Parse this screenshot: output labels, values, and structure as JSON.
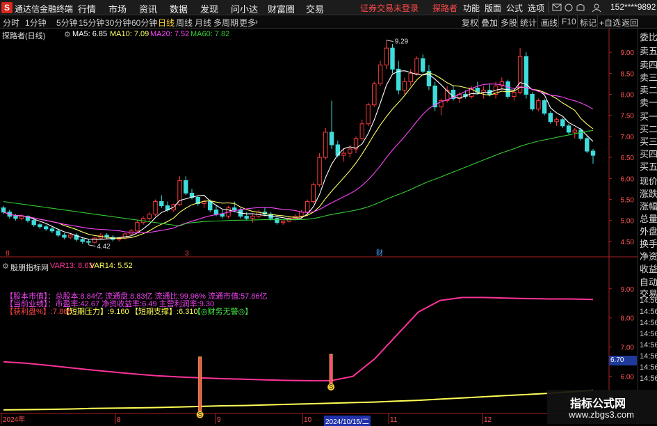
{
  "app": {
    "logo": "S",
    "title": "通达信金融终端",
    "menu": [
      "行情",
      "市场",
      "资讯",
      "数据",
      "发现",
      "问小达",
      "财富圈",
      "交易"
    ],
    "warning": "证券交易未登录",
    "user": "探路者",
    "right_menu": [
      "功能",
      "版面",
      "公式",
      "选项"
    ],
    "user_id": "152****9892"
  },
  "toolbar": {
    "periods": [
      "分时",
      "1分钟",
      "5分钟",
      "15分钟",
      "30分钟",
      "60分钟",
      "日线",
      "周线",
      "月线",
      "多周期",
      "更多"
    ],
    "right": [
      "复权",
      "叠加",
      "多股",
      "统计",
      "画线",
      "F10",
      "标记",
      "+自选",
      "返回"
    ]
  },
  "main_legend": {
    "name": "探路者(日线)",
    "ma5": "MA5: 6.85",
    "ma10": "MA10: 7.09",
    "ma20": "MA20: 7.52",
    "ma60": "MA60: 7.82"
  },
  "y_axis_main": [
    "9.00",
    "8.50",
    "8.00",
    "7.50",
    "7.00",
    "6.50",
    "6.00",
    "5.50",
    "5.00",
    "4.50"
  ],
  "annotations": {
    "high": "9.29",
    "low": "4.42"
  },
  "markers": [
    "8",
    "3",
    "财"
  ],
  "sub_legend": {
    "name": "殷朋指标网",
    "var13": "VAR13: 8.63",
    "var14": "VAR14: 5.52"
  },
  "info": {
    "row1": "【股本市值】：总股本:8.84亿 流通盘:8.83亿 流通比:99.96% 流通市值:57.86亿",
    "row2": "【当前业绩】：市盈率:42.67 净资收益率:6.49 主营利润率:9.30",
    "row3_a": "【获利盘%】:7.865",
    "row3_b": "【短期压力】:9.160",
    "row3_c": "【短期支撑】:6.310",
    "row3_d": "【◎财务无警◎】"
  },
  "y_axis_sub": [
    "9.00",
    "8.00",
    "7.00",
    "6.00"
  ],
  "price_tag": "6.70",
  "sub_markers": [
    "S",
    "S"
  ],
  "x_axis": [
    "2024年",
    "8",
    "9",
    "10",
    "11",
    "12"
  ],
  "date_tag": "2024/10/15/二",
  "sidebar": [
    "委比",
    "卖五",
    "卖四",
    "卖三",
    "卖二",
    "卖一",
    "买一",
    "买二",
    "买三",
    "买四",
    "买五",
    "现价",
    "涨跌",
    "涨幅",
    "总量",
    "外盘",
    "换手",
    "净资",
    "收益",
    "自动",
    "交易",
    "14:56",
    "14:56",
    "14:56",
    "14:56",
    "14:56",
    "14:56",
    "14:56",
    "14:56"
  ],
  "watermark": {
    "line1": "指标公式网",
    "line2": "www.zbgs3.com"
  },
  "colors": {
    "up": "#ff3b3b",
    "down": "#3fdcdc",
    "ma5": "#ffffff",
    "ma10": "#ffff66",
    "ma20": "#ff44ff",
    "ma60": "#33cc33",
    "var13": "#ff3399",
    "var14": "#ffff55",
    "axis": "#aa2222"
  },
  "chart_data": {
    "type": "candlestick",
    "ylim": [
      4.3,
      9.4
    ],
    "x_labels": [
      "2024年",
      "8",
      "9",
      "10",
      "11",
      "12"
    ],
    "ohlc": [
      [
        5.3,
        5.35,
        5.15,
        5.2
      ],
      [
        5.2,
        5.25,
        5.05,
        5.1
      ],
      [
        5.1,
        5.15,
        5.0,
        5.05
      ],
      [
        5.05,
        5.15,
        5.0,
        5.1
      ],
      [
        5.1,
        5.12,
        4.95,
        5.0
      ],
      [
        5.0,
        5.05,
        4.85,
        4.9
      ],
      [
        4.9,
        4.95,
        4.8,
        4.85
      ],
      [
        4.85,
        4.9,
        4.75,
        4.8
      ],
      [
        4.8,
        4.85,
        4.7,
        4.75
      ],
      [
        4.75,
        4.8,
        4.6,
        4.65
      ],
      [
        4.65,
        4.7,
        4.55,
        4.6
      ],
      [
        4.6,
        4.7,
        4.55,
        4.65
      ],
      [
        4.65,
        4.7,
        4.5,
        4.55
      ],
      [
        4.55,
        4.6,
        4.45,
        4.5
      ],
      [
        4.5,
        4.55,
        4.42,
        4.48
      ],
      [
        4.48,
        4.6,
        4.45,
        4.58
      ],
      [
        4.58,
        4.7,
        4.55,
        4.65
      ],
      [
        4.65,
        4.7,
        4.55,
        4.6
      ],
      [
        4.6,
        4.65,
        4.5,
        4.55
      ],
      [
        4.55,
        4.6,
        4.5,
        4.58
      ],
      [
        4.58,
        4.7,
        4.55,
        4.68
      ],
      [
        4.68,
        4.8,
        4.65,
        4.75
      ],
      [
        4.75,
        5.0,
        4.7,
        4.95
      ],
      [
        4.95,
        5.1,
        4.9,
        5.05
      ],
      [
        5.05,
        5.2,
        5.0,
        5.15
      ],
      [
        5.15,
        5.5,
        5.1,
        5.45
      ],
      [
        5.45,
        5.6,
        5.3,
        5.35
      ],
      [
        5.35,
        5.45,
        5.2,
        5.25
      ],
      [
        5.25,
        5.4,
        5.2,
        5.38
      ],
      [
        5.38,
        6.05,
        5.35,
        5.95
      ],
      [
        5.95,
        6.05,
        5.6,
        5.65
      ],
      [
        5.65,
        5.75,
        5.5,
        5.55
      ],
      [
        5.55,
        5.6,
        5.35,
        5.4
      ],
      [
        5.4,
        5.5,
        5.3,
        5.45
      ],
      [
        5.45,
        5.5,
        5.2,
        5.25
      ],
      [
        5.25,
        5.35,
        5.1,
        5.15
      ],
      [
        5.15,
        5.25,
        5.05,
        5.1
      ],
      [
        5.1,
        5.35,
        5.05,
        5.3
      ],
      [
        5.3,
        5.45,
        5.2,
        5.25
      ],
      [
        5.25,
        5.3,
        5.05,
        5.1
      ],
      [
        5.1,
        5.2,
        5.0,
        5.05
      ],
      [
        5.05,
        5.15,
        4.95,
        5.1
      ],
      [
        5.1,
        5.25,
        5.05,
        5.2
      ],
      [
        5.2,
        5.3,
        5.1,
        5.15
      ],
      [
        5.15,
        5.2,
        5.0,
        5.05
      ],
      [
        5.05,
        5.1,
        4.9,
        4.95
      ],
      [
        4.95,
        5.0,
        4.9,
        4.98
      ],
      [
        4.98,
        5.1,
        4.95,
        5.05
      ],
      [
        5.05,
        5.15,
        5.0,
        5.1
      ],
      [
        5.1,
        5.25,
        5.05,
        5.2
      ],
      [
        5.2,
        5.5,
        5.15,
        5.45
      ],
      [
        5.45,
        5.9,
        5.4,
        5.85
      ],
      [
        5.85,
        6.6,
        5.8,
        6.5
      ],
      [
        6.5,
        7.2,
        6.45,
        7.1
      ],
      [
        7.1,
        7.85,
        6.7,
        6.8
      ],
      [
        6.8,
        6.9,
        6.5,
        6.55
      ],
      [
        6.55,
        6.7,
        6.4,
        6.6
      ],
      [
        6.6,
        6.8,
        6.5,
        6.7
      ],
      [
        6.7,
        7.0,
        6.6,
        6.95
      ],
      [
        6.95,
        7.4,
        6.9,
        7.3
      ],
      [
        7.3,
        7.8,
        7.25,
        7.75
      ],
      [
        7.75,
        8.3,
        7.7,
        8.25
      ],
      [
        8.25,
        8.8,
        8.2,
        8.7
      ],
      [
        8.7,
        9.29,
        8.6,
        9.1
      ],
      [
        9.1,
        9.2,
        8.5,
        8.6
      ],
      [
        8.6,
        8.8,
        8.0,
        8.1
      ],
      [
        8.1,
        8.4,
        8.0,
        8.3
      ],
      [
        8.3,
        8.6,
        8.2,
        8.5
      ],
      [
        8.5,
        8.9,
        8.45,
        8.85
      ],
      [
        8.85,
        8.95,
        8.5,
        8.55
      ],
      [
        8.55,
        8.7,
        8.1,
        8.2
      ],
      [
        8.2,
        8.3,
        7.6,
        7.7
      ],
      [
        7.7,
        7.9,
        7.5,
        7.85
      ],
      [
        7.85,
        8.2,
        7.8,
        8.1
      ],
      [
        8.1,
        8.2,
        7.85,
        7.9
      ],
      [
        7.9,
        8.05,
        7.8,
        8.0
      ],
      [
        8.0,
        8.1,
        7.9,
        7.95
      ],
      [
        7.95,
        8.2,
        7.9,
        8.15
      ],
      [
        8.15,
        8.3,
        8.0,
        8.05
      ],
      [
        8.05,
        8.2,
        7.9,
        8.1
      ],
      [
        8.1,
        8.25,
        7.95,
        8.0
      ],
      [
        8.0,
        8.3,
        7.9,
        8.2
      ],
      [
        8.2,
        8.4,
        8.1,
        8.3
      ],
      [
        8.3,
        8.35,
        7.9,
        7.95
      ],
      [
        7.95,
        8.1,
        7.85,
        8.05
      ],
      [
        8.05,
        9.1,
        8.0,
        8.9
      ],
      [
        8.9,
        9.0,
        7.9,
        8.0
      ],
      [
        8.0,
        8.05,
        7.6,
        7.65
      ],
      [
        7.65,
        7.9,
        7.6,
        7.85
      ],
      [
        7.85,
        7.9,
        7.5,
        7.55
      ],
      [
        7.55,
        7.6,
        7.3,
        7.35
      ],
      [
        7.35,
        7.45,
        7.25,
        7.4
      ],
      [
        7.4,
        7.45,
        7.2,
        7.25
      ],
      [
        7.25,
        7.3,
        7.05,
        7.1
      ],
      [
        7.1,
        7.2,
        6.95,
        7.15
      ],
      [
        7.15,
        7.2,
        6.9,
        6.95
      ],
      [
        6.95,
        7.0,
        6.6,
        6.65
      ],
      [
        6.65,
        6.7,
        6.35,
        6.55
      ]
    ],
    "series": [
      {
        "name": "MA5"
      },
      {
        "name": "MA10"
      },
      {
        "name": "MA20"
      },
      {
        "name": "MA60"
      }
    ],
    "sub": {
      "type": "line",
      "ylim": [
        4.8,
        9.4
      ],
      "var13": [
        6.5,
        6.45,
        6.38,
        6.3,
        6.22,
        6.15,
        6.08,
        6.02,
        5.98,
        5.95,
        5.92,
        5.9,
        5.88,
        5.86,
        5.85,
        5.85,
        6.0,
        6.6,
        7.4,
        8.2,
        8.6,
        8.7,
        8.7,
        8.68,
        8.66,
        8.65,
        8.65,
        8.63
      ],
      "var14": [
        4.85,
        4.86,
        4.87,
        4.88,
        4.9,
        4.91,
        4.92,
        4.93,
        4.95,
        4.97,
        4.99,
        5.0,
        5.02,
        5.04,
        5.06,
        5.08,
        5.1,
        5.12,
        5.15,
        5.18,
        5.22,
        5.26,
        5.3,
        5.34,
        5.38,
        5.42,
        5.47,
        5.52
      ],
      "signals": [
        {
          "index": 9,
          "label": "S"
        },
        {
          "index": 15,
          "label": "S"
        }
      ]
    }
  }
}
